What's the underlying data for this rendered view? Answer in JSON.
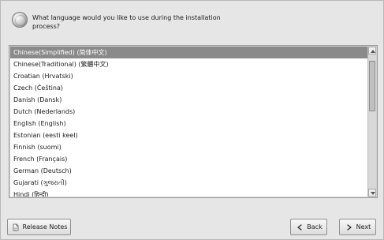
{
  "dialog": {
    "prompt": "What language would you like to use during the installation process?"
  },
  "languages": [
    "Chinese(Simplified) (简体中文)",
    "Chinese(Traditional) (繁體中文)",
    "Croatian (Hrvatski)",
    "Czech (Čeština)",
    "Danish (Dansk)",
    "Dutch (Nederlands)",
    "English (English)",
    "Estonian (eesti keel)",
    "Finnish (suomi)",
    "French (Français)",
    "German (Deutsch)",
    "Gujarati (ગુજરાતી)",
    "Hindi (हिन्दी)"
  ],
  "selected_index": 0,
  "buttons": {
    "release_notes": "Release Notes",
    "back": "Back",
    "next": "Next"
  },
  "icons": {
    "prompt": "globe-icon",
    "release_notes": "document-icon",
    "back": "back-arrow-icon",
    "next": "next-arrow-icon"
  }
}
